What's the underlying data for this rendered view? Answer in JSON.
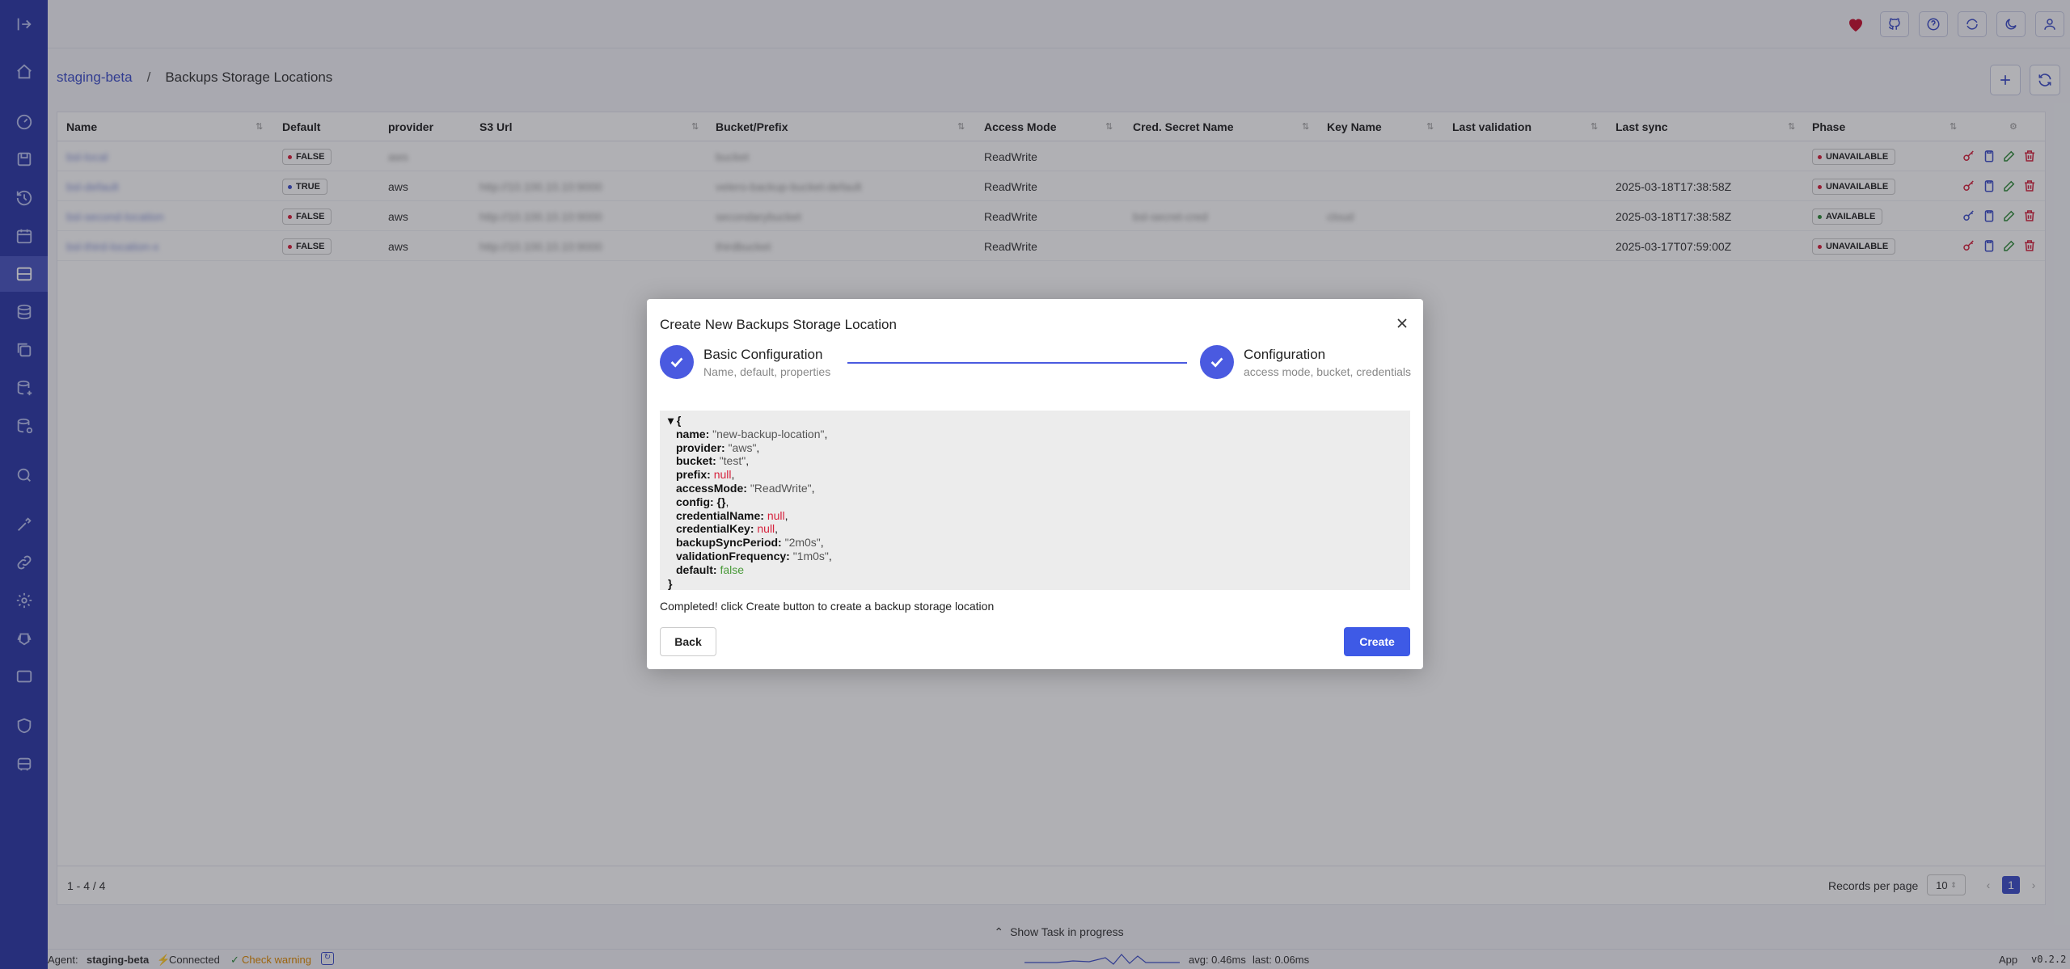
{
  "breadcrumb": {
    "agent": "staging-beta",
    "separator": "/",
    "current": "Backups Storage Locations"
  },
  "table": {
    "columns": [
      "Name",
      "Default",
      "provider",
      "S3 Url",
      "Bucket/Prefix",
      "Access Mode",
      "Cred. Secret Name",
      "Key Name",
      "Last validation",
      "Last sync",
      "Phase"
    ],
    "rows": [
      {
        "name": "bsl-local",
        "default": "FALSE",
        "provider": "aws",
        "s3url": "",
        "bucket": "bucket",
        "access": "ReadWrite",
        "cred": "",
        "key": "",
        "lastval": "",
        "lastsync": "",
        "phase": "UNAVAILABLE"
      },
      {
        "name": "bsl-default",
        "default": "TRUE",
        "provider": "aws",
        "s3url": "http://10.100.10.10:9000",
        "bucket": "velero-backup-bucket-default",
        "access": "ReadWrite",
        "cred": "",
        "key": "",
        "lastval": "",
        "lastsync": "2025-03-18T17:38:58Z",
        "phase": "UNAVAILABLE"
      },
      {
        "name": "bsl-second-location",
        "default": "FALSE",
        "provider": "aws",
        "s3url": "http://10.100.10.10:9000",
        "bucket": "secondarybucket",
        "access": "ReadWrite",
        "cred": "bsl-secret-cred",
        "key": "cloud",
        "lastval": "",
        "lastsync": "2025-03-18T17:38:58Z",
        "phase": "AVAILABLE"
      },
      {
        "name": "bsl-third-location-x",
        "default": "FALSE",
        "provider": "aws",
        "s3url": "http://10.100.10.10:9000",
        "bucket": "thirdbucket",
        "access": "ReadWrite",
        "cred": "",
        "key": "",
        "lastval": "",
        "lastsync": "2025-03-17T07:59:00Z",
        "phase": "UNAVAILABLE"
      }
    ]
  },
  "footer": {
    "range": "1 - 4 / 4",
    "records_label": "Records per page",
    "records_value": "10",
    "page": "1",
    "prev": "‹",
    "next": "›"
  },
  "task_bar": {
    "label": "Show Task in progress"
  },
  "status": {
    "agent_label": "Agent:",
    "agent_name": "staging-beta",
    "connected": "Connected",
    "check": "Check warning",
    "avg": "avg: 0.46ms",
    "last": "last: 0.06ms",
    "app": "App",
    "version": "v0.2.2"
  },
  "modal": {
    "title": "Create New Backups Storage Location",
    "step1_title": "Basic Configuration",
    "step1_desc": "Name, default, properties",
    "step2_title": "Configuration",
    "step2_desc": "access mode, bucket, credentials",
    "json_open": "▾ {",
    "json_close": "}",
    "json_lines": [
      {
        "key": "name:",
        "val": "\"new-backup-location\"",
        "type": "str"
      },
      {
        "key": "provider:",
        "val": "\"aws\"",
        "type": "str"
      },
      {
        "key": "bucket:",
        "val": "\"test\"",
        "type": "str"
      },
      {
        "key": "prefix:",
        "val": "null",
        "type": "null"
      },
      {
        "key": "accessMode:",
        "val": "\"ReadWrite\"",
        "type": "str"
      },
      {
        "key": "config:",
        "val": "{}",
        "type": "obj"
      },
      {
        "key": "credentialName:",
        "val": "null",
        "type": "null"
      },
      {
        "key": "credentialKey:",
        "val": "null",
        "type": "null"
      },
      {
        "key": "backupSyncPeriod:",
        "val": "\"2m0s\"",
        "type": "str"
      },
      {
        "key": "validationFrequency:",
        "val": "\"1m0s\"",
        "type": "str"
      },
      {
        "key": "default:",
        "val": "false",
        "type": "bool",
        "last": true
      }
    ],
    "message": "Completed! click Create button to create a backup storage location",
    "back": "Back",
    "create": "Create"
  },
  "colors": {
    "primary": "#3e4fc9",
    "sidebar": "#2d3aa8",
    "danger": "#d6213c",
    "success": "#2e8b3a",
    "chip_red": "#d6213c",
    "chip_green": "#2e8b3a",
    "chip_blue": "#3e4fc9"
  }
}
